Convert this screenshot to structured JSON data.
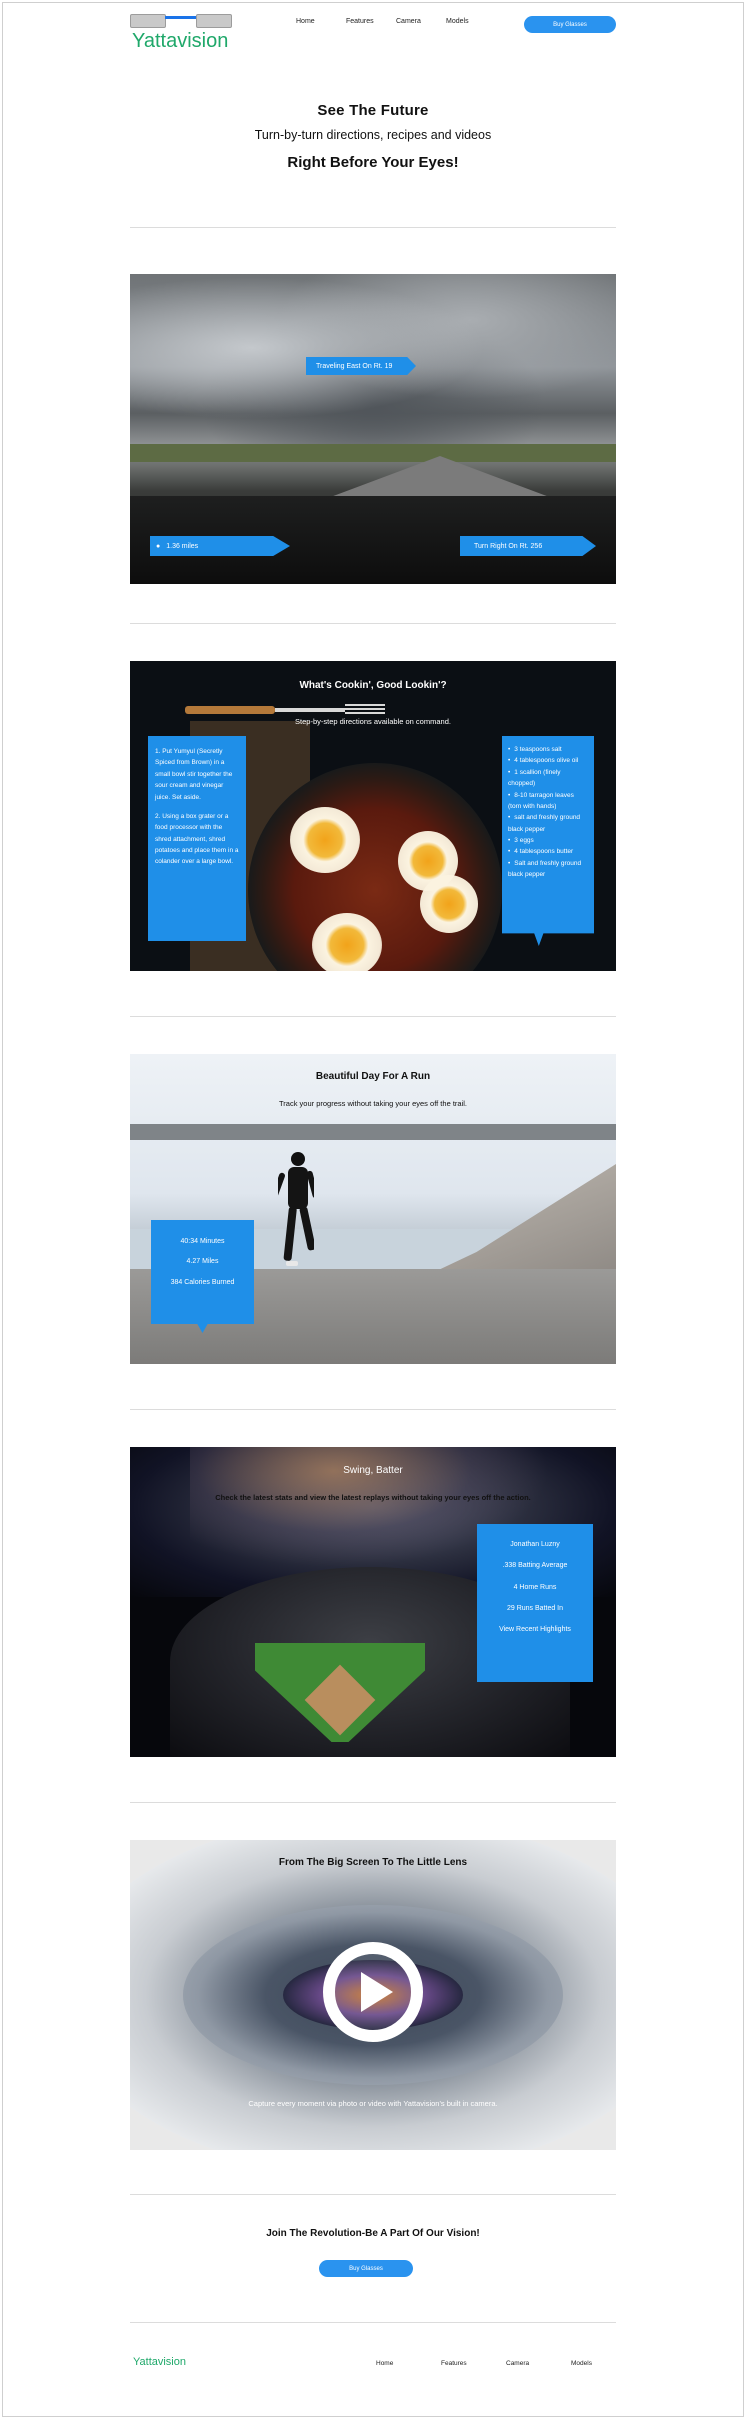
{
  "header": {
    "logo_text": "Yattavision",
    "nav": [
      "Home",
      "Features",
      "Camera",
      "Models"
    ],
    "buy_button": "Buy Glasses"
  },
  "hero": {
    "title": "See The Future",
    "subtitle": "Turn-by-turn directions, recipes and videos",
    "tagline": "Right Before Your Eyes!"
  },
  "navigation_panel": {
    "direction_top": "Traveling East On Rt. 19",
    "distance": "1.36 miles",
    "next_turn": "Turn Right On Rt. 256"
  },
  "cooking_panel": {
    "title": "What's Cookin', Good Lookin'?",
    "subtitle": "Step-by-step directions available on command.",
    "steps": [
      "1. Put Yumyul (Secretly Spiced from Brown) in a small bowl stir together the sour cream and vinegar juice. Set aside.",
      "2. Using a box grater or a food processor with the shred attachment, shred potatoes and place them in a colander over a large bowl."
    ],
    "ingredients": [
      "3 teaspoons salt",
      "4 tablespoons olive oil",
      "1 scallion (finely chopped)",
      "8-10 tarragon leaves (torn with hands)",
      "salt and freshly ground black pepper",
      "3 eggs",
      "4 tablespoons butter",
      "Salt and freshly ground black pepper"
    ]
  },
  "run_panel": {
    "title": "Beautiful Day For A Run",
    "subtitle": "Track your progress without taking your eyes off the trail.",
    "stats": [
      "40:34 Minutes",
      "4.27 Miles",
      "384 Calories Burned"
    ]
  },
  "baseball_panel": {
    "title": "Swing, Batter",
    "subtitle": "Check the latest stats and view the latest replays without taking your eyes off the action.",
    "stats": [
      "Jonathan Luzny",
      ".338 Batting Average",
      "4 Home Runs",
      "29 Runs Batted In",
      "View Recent Highlights"
    ]
  },
  "camera_panel": {
    "title": "From The Big Screen To The Little Lens",
    "caption": "Capture every moment via photo or video with Yattavision's built in camera."
  },
  "join": {
    "text": "Join The Revolution-Be A Part Of Our Vision!",
    "button": "Buy Glasses"
  },
  "footer": {
    "logo_text": "Yattavision",
    "nav": [
      "Home",
      "Features",
      "Camera",
      "Models"
    ]
  },
  "colors": {
    "accent": "#2a93ef",
    "brand": "#1fa86a"
  }
}
